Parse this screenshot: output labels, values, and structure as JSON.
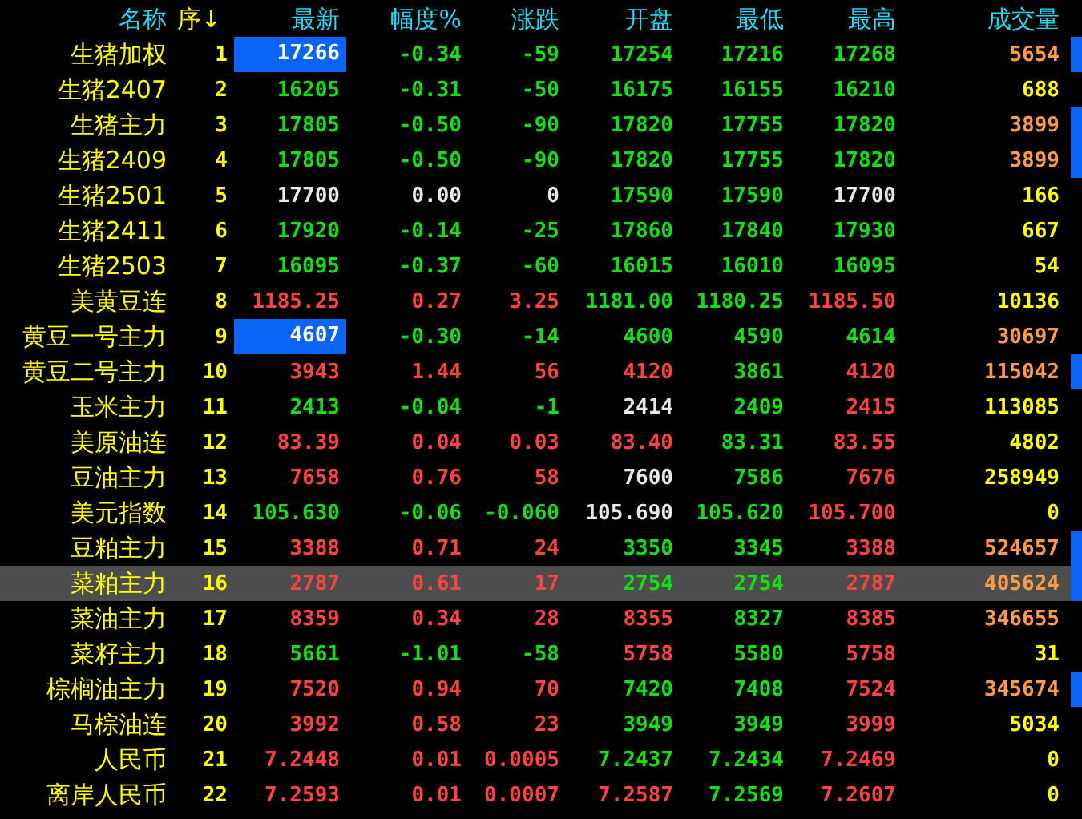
{
  "columns": [
    {
      "label": "名称"
    },
    {
      "label": "序↓"
    },
    {
      "label": "最新"
    },
    {
      "label": "幅度%"
    },
    {
      "label": "涨跌"
    },
    {
      "label": "开盘"
    },
    {
      "label": "最低"
    },
    {
      "label": "最高"
    },
    {
      "label": "成交量"
    }
  ],
  "rows": [
    {
      "name": "生猪加权",
      "no": "1",
      "flash": true,
      "marker": true,
      "selected": false,
      "cells": [
        {
          "text": "17266"
        },
        {
          "text": "-0.34",
          "color": "#11e011"
        },
        {
          "text": "-59",
          "color": "#11e011"
        },
        {
          "text": "17254",
          "color": "#11e011"
        },
        {
          "text": "17216",
          "color": "#11e011"
        },
        {
          "text": "17268",
          "color": "#11e011"
        },
        {
          "text": "5654",
          "color": "#ff9a48"
        }
      ]
    },
    {
      "name": "生猪2407",
      "no": "2",
      "flash": false,
      "marker": false,
      "selected": false,
      "cells": [
        {
          "text": "16205",
          "color": "#11e011"
        },
        {
          "text": "-0.31",
          "color": "#11e011"
        },
        {
          "text": "-50",
          "color": "#11e011"
        },
        {
          "text": "16175",
          "color": "#11e011"
        },
        {
          "text": "16155",
          "color": "#11e011"
        },
        {
          "text": "16210",
          "color": "#11e011"
        },
        {
          "text": "688",
          "color": "#ffff00"
        }
      ]
    },
    {
      "name": "生猪主力",
      "no": "3",
      "flash": false,
      "marker": true,
      "selected": false,
      "cells": [
        {
          "text": "17805",
          "color": "#11e011"
        },
        {
          "text": "-0.50",
          "color": "#11e011"
        },
        {
          "text": "-90",
          "color": "#11e011"
        },
        {
          "text": "17820",
          "color": "#11e011"
        },
        {
          "text": "17755",
          "color": "#11e011"
        },
        {
          "text": "17820",
          "color": "#11e011"
        },
        {
          "text": "3899",
          "color": "#ff9a48"
        }
      ]
    },
    {
      "name": "生猪2409",
      "no": "4",
      "flash": false,
      "marker": true,
      "selected": false,
      "cells": [
        {
          "text": "17805",
          "color": "#11e011"
        },
        {
          "text": "-0.50",
          "color": "#11e011"
        },
        {
          "text": "-90",
          "color": "#11e011"
        },
        {
          "text": "17820",
          "color": "#11e011"
        },
        {
          "text": "17755",
          "color": "#11e011"
        },
        {
          "text": "17820",
          "color": "#11e011"
        },
        {
          "text": "3899",
          "color": "#ff9a48"
        }
      ]
    },
    {
      "name": "生猪2501",
      "no": "5",
      "flash": false,
      "marker": false,
      "selected": false,
      "cells": [
        {
          "text": "17700",
          "color": "#e8e8e8"
        },
        {
          "text": "0.00",
          "color": "#e8e8e8"
        },
        {
          "text": "0",
          "color": "#e8e8e8"
        },
        {
          "text": "17590",
          "color": "#11e011"
        },
        {
          "text": "17590",
          "color": "#11e011"
        },
        {
          "text": "17700",
          "color": "#e8e8e8"
        },
        {
          "text": "166",
          "color": "#ffff00"
        }
      ]
    },
    {
      "name": "生猪2411",
      "no": "6",
      "flash": false,
      "marker": false,
      "selected": false,
      "cells": [
        {
          "text": "17920",
          "color": "#11e011"
        },
        {
          "text": "-0.14",
          "color": "#11e011"
        },
        {
          "text": "-25",
          "color": "#11e011"
        },
        {
          "text": "17860",
          "color": "#11e011"
        },
        {
          "text": "17840",
          "color": "#11e011"
        },
        {
          "text": "17930",
          "color": "#11e011"
        },
        {
          "text": "667",
          "color": "#ffff00"
        }
      ]
    },
    {
      "name": "生猪2503",
      "no": "7",
      "flash": false,
      "marker": false,
      "selected": false,
      "cells": [
        {
          "text": "16095",
          "color": "#11e011"
        },
        {
          "text": "-0.37",
          "color": "#11e011"
        },
        {
          "text": "-60",
          "color": "#11e011"
        },
        {
          "text": "16015",
          "color": "#11e011"
        },
        {
          "text": "16010",
          "color": "#11e011"
        },
        {
          "text": "16095",
          "color": "#11e011"
        },
        {
          "text": "54",
          "color": "#ffff00"
        }
      ]
    },
    {
      "name": "美黄豆连",
      "no": "8",
      "flash": false,
      "marker": false,
      "selected": false,
      "cells": [
        {
          "text": "1185.25",
          "color": "#ff4242"
        },
        {
          "text": "0.27",
          "color": "#ff4242"
        },
        {
          "text": "3.25",
          "color": "#ff4242"
        },
        {
          "text": "1181.00",
          "color": "#11e011"
        },
        {
          "text": "1180.25",
          "color": "#11e011"
        },
        {
          "text": "1185.50",
          "color": "#ff4242"
        },
        {
          "text": "10136",
          "color": "#ffff00"
        }
      ]
    },
    {
      "name": "黄豆一号主力",
      "no": "9",
      "flash": true,
      "marker": false,
      "selected": false,
      "cells": [
        {
          "text": "4607"
        },
        {
          "text": "-0.30",
          "color": "#11e011"
        },
        {
          "text": "-14",
          "color": "#11e011"
        },
        {
          "text": "4600",
          "color": "#11e011"
        },
        {
          "text": "4590",
          "color": "#11e011"
        },
        {
          "text": "4614",
          "color": "#11e011"
        },
        {
          "text": "30697",
          "color": "#ff9a48"
        }
      ]
    },
    {
      "name": "黄豆二号主力",
      "no": "10",
      "flash": false,
      "marker": true,
      "selected": false,
      "cells": [
        {
          "text": "3943",
          "color": "#ff4242"
        },
        {
          "text": "1.44",
          "color": "#ff4242"
        },
        {
          "text": "56",
          "color": "#ff4242"
        },
        {
          "text": "4120",
          "color": "#ff4242"
        },
        {
          "text": "3861",
          "color": "#11e011"
        },
        {
          "text": "4120",
          "color": "#ff4242"
        },
        {
          "text": "115042",
          "color": "#ff9a48"
        }
      ]
    },
    {
      "name": "玉米主力",
      "no": "11",
      "flash": false,
      "marker": false,
      "selected": false,
      "cells": [
        {
          "text": "2413",
          "color": "#11e011"
        },
        {
          "text": "-0.04",
          "color": "#11e011"
        },
        {
          "text": "-1",
          "color": "#11e011"
        },
        {
          "text": "2414",
          "color": "#e8e8e8"
        },
        {
          "text": "2409",
          "color": "#11e011"
        },
        {
          "text": "2415",
          "color": "#ff4242"
        },
        {
          "text": "113085",
          "color": "#ffff00"
        }
      ]
    },
    {
      "name": "美原油连",
      "no": "12",
      "flash": false,
      "marker": false,
      "selected": false,
      "cells": [
        {
          "text": "83.39",
          "color": "#ff4242"
        },
        {
          "text": "0.04",
          "color": "#ff4242"
        },
        {
          "text": "0.03",
          "color": "#ff4242"
        },
        {
          "text": "83.40",
          "color": "#ff4242"
        },
        {
          "text": "83.31",
          "color": "#11e011"
        },
        {
          "text": "83.55",
          "color": "#ff4242"
        },
        {
          "text": "4802",
          "color": "#ffff00"
        }
      ]
    },
    {
      "name": "豆油主力",
      "no": "13",
      "flash": false,
      "marker": false,
      "selected": false,
      "cells": [
        {
          "text": "7658",
          "color": "#ff4242"
        },
        {
          "text": "0.76",
          "color": "#ff4242"
        },
        {
          "text": "58",
          "color": "#ff4242"
        },
        {
          "text": "7600",
          "color": "#e8e8e8"
        },
        {
          "text": "7586",
          "color": "#11e011"
        },
        {
          "text": "7676",
          "color": "#ff4242"
        },
        {
          "text": "258949",
          "color": "#ffff00"
        }
      ]
    },
    {
      "name": "美元指数",
      "no": "14",
      "flash": false,
      "marker": false,
      "selected": false,
      "cells": [
        {
          "text": "105.630",
          "color": "#11e011"
        },
        {
          "text": "-0.06",
          "color": "#11e011"
        },
        {
          "text": "-0.060",
          "color": "#11e011"
        },
        {
          "text": "105.690",
          "color": "#e8e8e8"
        },
        {
          "text": "105.620",
          "color": "#11e011"
        },
        {
          "text": "105.700",
          "color": "#ff4242"
        },
        {
          "text": "0",
          "color": "#ffff00"
        }
      ]
    },
    {
      "name": "豆粕主力",
      "no": "15",
      "flash": false,
      "marker": true,
      "selected": false,
      "cells": [
        {
          "text": "3388",
          "color": "#ff4242"
        },
        {
          "text": "0.71",
          "color": "#ff4242"
        },
        {
          "text": "24",
          "color": "#ff4242"
        },
        {
          "text": "3350",
          "color": "#11e011"
        },
        {
          "text": "3345",
          "color": "#11e011"
        },
        {
          "text": "3388",
          "color": "#ff4242"
        },
        {
          "text": "524657",
          "color": "#ff9a48"
        }
      ]
    },
    {
      "name": "菜粕主力",
      "no": "16",
      "flash": false,
      "marker": true,
      "selected": true,
      "cells": [
        {
          "text": "2787",
          "color": "#ff4242"
        },
        {
          "text": "0.61",
          "color": "#ff4242"
        },
        {
          "text": "17",
          "color": "#ff4242"
        },
        {
          "text": "2754",
          "color": "#11e011"
        },
        {
          "text": "2754",
          "color": "#11e011"
        },
        {
          "text": "2787",
          "color": "#ff4242"
        },
        {
          "text": "405624",
          "color": "#ff9a48"
        }
      ]
    },
    {
      "name": "菜油主力",
      "no": "17",
      "flash": false,
      "marker": false,
      "selected": false,
      "cells": [
        {
          "text": "8359",
          "color": "#ff4242"
        },
        {
          "text": "0.34",
          "color": "#ff4242"
        },
        {
          "text": "28",
          "color": "#ff4242"
        },
        {
          "text": "8355",
          "color": "#ff4242"
        },
        {
          "text": "8327",
          "color": "#11e011"
        },
        {
          "text": "8385",
          "color": "#ff4242"
        },
        {
          "text": "346655",
          "color": "#ff9a48"
        }
      ]
    },
    {
      "name": "菜籽主力",
      "no": "18",
      "flash": false,
      "marker": false,
      "selected": false,
      "cells": [
        {
          "text": "5661",
          "color": "#11e011"
        },
        {
          "text": "-1.01",
          "color": "#11e011"
        },
        {
          "text": "-58",
          "color": "#11e011"
        },
        {
          "text": "5758",
          "color": "#ff4242"
        },
        {
          "text": "5580",
          "color": "#11e011"
        },
        {
          "text": "5758",
          "color": "#ff4242"
        },
        {
          "text": "31",
          "color": "#ffff00"
        }
      ]
    },
    {
      "name": "棕榈油主力",
      "no": "19",
      "flash": false,
      "marker": true,
      "selected": false,
      "cells": [
        {
          "text": "7520",
          "color": "#ff4242"
        },
        {
          "text": "0.94",
          "color": "#ff4242"
        },
        {
          "text": "70",
          "color": "#ff4242"
        },
        {
          "text": "7420",
          "color": "#11e011"
        },
        {
          "text": "7408",
          "color": "#11e011"
        },
        {
          "text": "7524",
          "color": "#ff4242"
        },
        {
          "text": "345674",
          "color": "#ff9a48"
        }
      ]
    },
    {
      "name": "马棕油连",
      "no": "20",
      "flash": false,
      "marker": false,
      "selected": false,
      "cells": [
        {
          "text": "3992",
          "color": "#ff4242"
        },
        {
          "text": "0.58",
          "color": "#ff4242"
        },
        {
          "text": "23",
          "color": "#ff4242"
        },
        {
          "text": "3949",
          "color": "#11e011"
        },
        {
          "text": "3949",
          "color": "#11e011"
        },
        {
          "text": "3999",
          "color": "#ff4242"
        },
        {
          "text": "5034",
          "color": "#ffff00"
        }
      ]
    },
    {
      "name": "人民币",
      "no": "21",
      "flash": false,
      "marker": false,
      "selected": false,
      "cells": [
        {
          "text": "7.2448",
          "color": "#ff4242"
        },
        {
          "text": "0.01",
          "color": "#ff4242"
        },
        {
          "text": "0.0005",
          "color": "#ff4242"
        },
        {
          "text": "7.2437",
          "color": "#11e011"
        },
        {
          "text": "7.2434",
          "color": "#11e011"
        },
        {
          "text": "7.2469",
          "color": "#ff4242"
        },
        {
          "text": "0",
          "color": "#ffff00"
        }
      ]
    },
    {
      "name": "离岸人民币",
      "no": "22",
      "flash": false,
      "marker": false,
      "selected": false,
      "cells": [
        {
          "text": "7.2593",
          "color": "#ff4242"
        },
        {
          "text": "0.01",
          "color": "#ff4242"
        },
        {
          "text": "0.0007",
          "color": "#ff4242"
        },
        {
          "text": "7.2587",
          "color": "#ff4242"
        },
        {
          "text": "7.2569",
          "color": "#11e011"
        },
        {
          "text": "7.2607",
          "color": "#ff4242"
        },
        {
          "text": "0",
          "color": "#ffff00"
        }
      ]
    }
  ]
}
